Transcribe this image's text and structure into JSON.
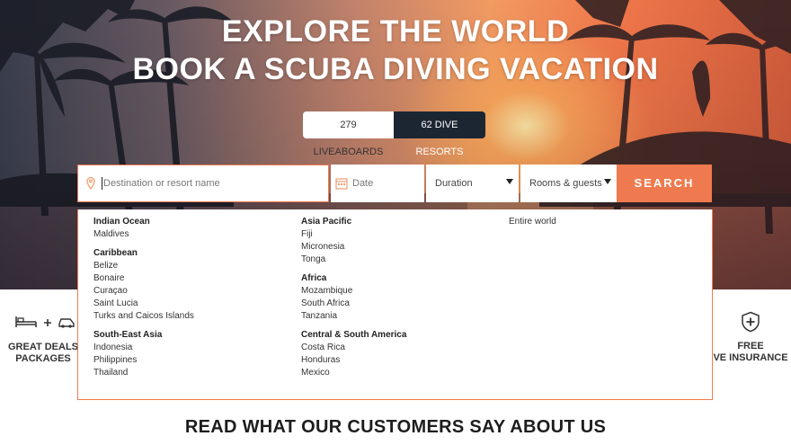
{
  "hero": {
    "headline_line1": "EXPLORE THE WORLD",
    "headline_line2": "BOOK A SCUBA DIVING VACATION"
  },
  "toggle": {
    "liveaboards": "279 LIVEABOARDS",
    "resorts": "62 DIVE RESORTS"
  },
  "search": {
    "destination_placeholder": "Destination or resort name",
    "date_placeholder": "Date",
    "duration_label": "Duration",
    "rooms_label": "Rooms & guests",
    "button_label": "SEARCH"
  },
  "dropdown": {
    "col1": [
      {
        "title": "Indian Ocean",
        "items": [
          "Maldives"
        ]
      },
      {
        "title": "Caribbean",
        "items": [
          "Belize",
          "Bonaire",
          "Curaçao",
          "Saint Lucia",
          "Turks and Caicos Islands"
        ]
      },
      {
        "title": "South-East Asia",
        "items": [
          "Indonesia",
          "Philippines",
          "Thailand"
        ]
      }
    ],
    "col2": [
      {
        "title": "Asia Pacific",
        "items": [
          "Fiji",
          "Micronesia",
          "Tonga"
        ]
      },
      {
        "title": "Africa",
        "items": [
          "Mozambique",
          "South Africa",
          "Tanzania"
        ]
      },
      {
        "title": "Central & South America",
        "items": [
          "Costa Rica",
          "Honduras",
          "Mexico"
        ]
      }
    ],
    "col3_item": "Entire world"
  },
  "features": {
    "left_line1": "GREAT DEALS",
    "left_line2": "PACKAGES",
    "right_line1": "FREE",
    "right_line2": "VE INSURANCE"
  },
  "section": {
    "title": "READ WHAT OUR CUSTOMERS SAY ABOUT US"
  },
  "colors": {
    "accent": "#f07a4f",
    "dark": "#1c2633"
  },
  "icons": [
    "location-pin-icon",
    "calendar-icon",
    "caret-down-icon",
    "bed-icon",
    "plus-icon",
    "car-icon",
    "shield-plus-icon"
  ]
}
